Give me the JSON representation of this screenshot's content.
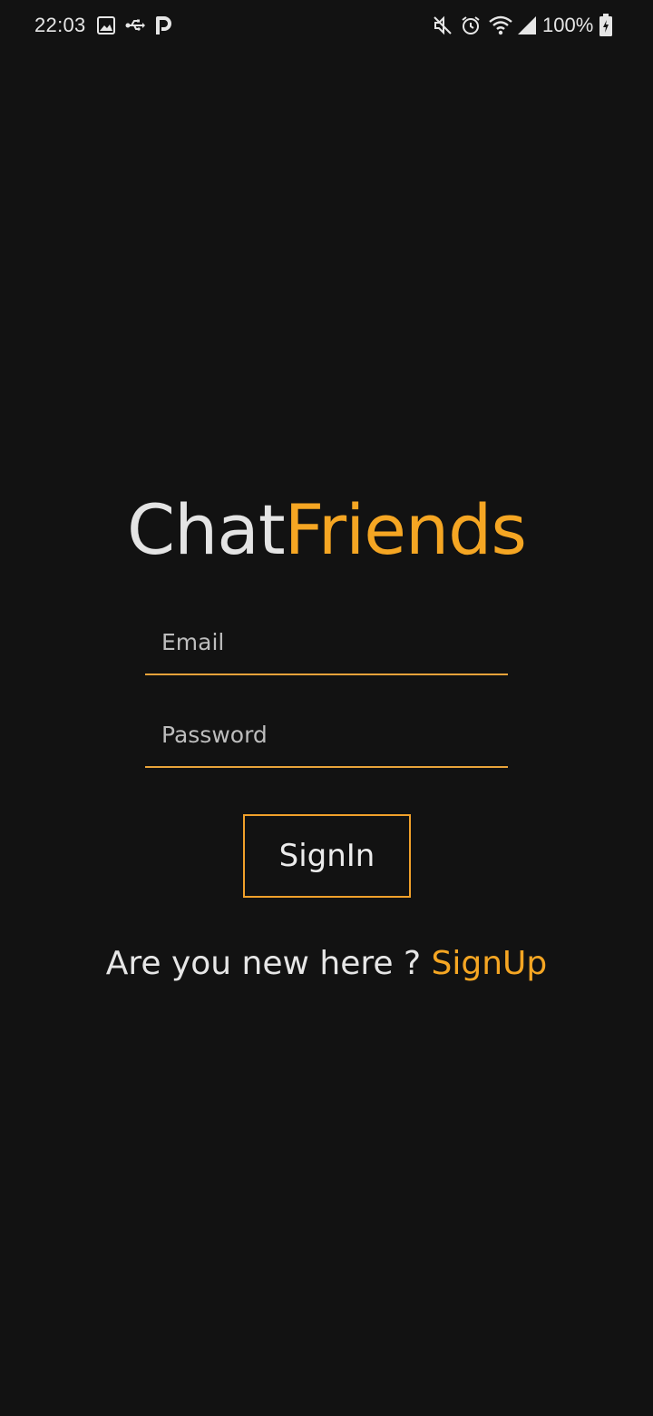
{
  "status_bar": {
    "time": "22:03",
    "battery": "100%",
    "icons": [
      "image-icon",
      "usb-icon",
      "parking-icon",
      "mute-icon",
      "alarm-icon",
      "wifi-icon",
      "signal-icon",
      "battery-icon"
    ]
  },
  "app": {
    "title_part_1": "Chat",
    "title_part_2": "Friends",
    "accent_color": "#f5a623",
    "background_color": "#121212"
  },
  "form": {
    "email_placeholder": "Email",
    "email_value": "",
    "password_placeholder": "Password",
    "password_value": "",
    "signin_label": "SignIn"
  },
  "signup": {
    "prompt": "Are you new here ? ",
    "link_label": "SignUp"
  }
}
